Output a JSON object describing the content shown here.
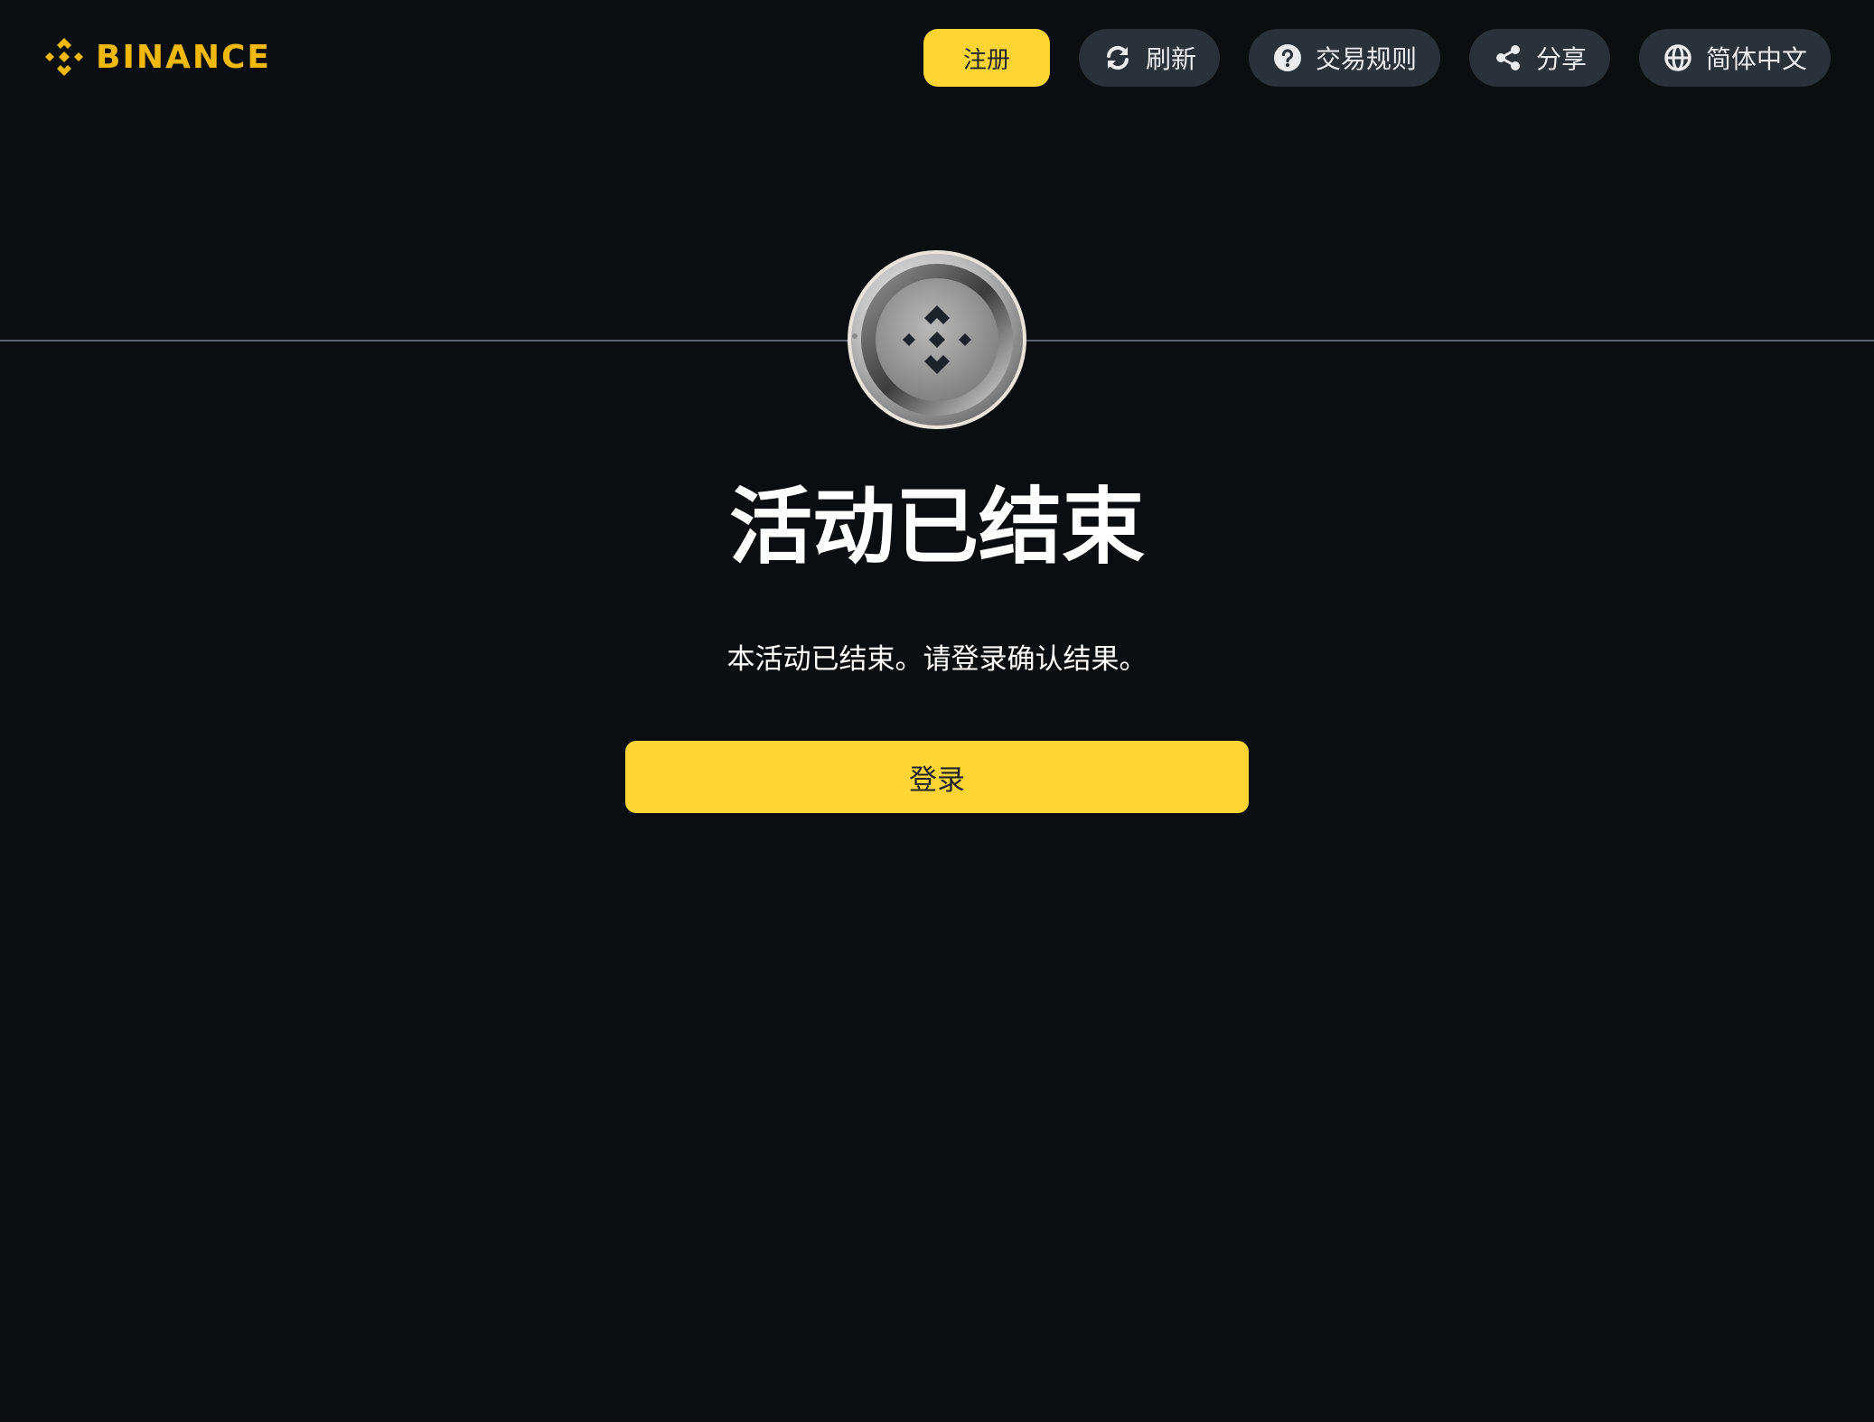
{
  "header": {
    "logo_text": "BINANCE",
    "register_label": "注册",
    "refresh_label": "刷新",
    "rules_label": "交易规则",
    "share_label": "分享",
    "language_label": "简体中文"
  },
  "main": {
    "title": "活动已结束",
    "message": "本活动已结束。请登录确认结果。",
    "login_label": "登录"
  },
  "icons": {
    "logo": "binance-logo-icon",
    "refresh": "refresh-icon",
    "rules": "question-circle-icon",
    "share": "share-icon",
    "language": "globe-icon",
    "coin": "bnb-coin-icon"
  },
  "colors": {
    "background": "#0b0e11",
    "brand_yellow": "#fcd535",
    "logo_yellow": "#f0b90b",
    "pill_bg": "#2b3139",
    "text_primary": "#ffffff"
  }
}
